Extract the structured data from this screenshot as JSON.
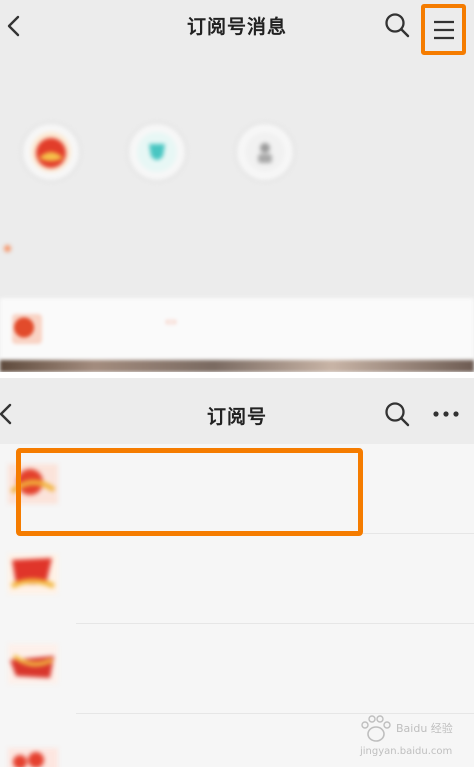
{
  "top_screen": {
    "title": "订阅号消息",
    "recent_label": "",
    "recent_accounts": [
      {
        "name": ""
      },
      {
        "name": ""
      },
      {
        "name": ""
      }
    ],
    "filters": [
      "",
      ""
    ],
    "feed_item": {
      "name": "",
      "tag": "",
      "time": ""
    }
  },
  "bottom_screen": {
    "title": "订阅号",
    "rows": [
      {
        "name": "",
        "snippet": "",
        "time": ""
      },
      {
        "name": "",
        "snippet": "",
        "time": ""
      },
      {
        "name": "",
        "snippet": "",
        "time": ""
      },
      {
        "name": "",
        "snippet": "",
        "time": ""
      }
    ]
  },
  "watermark": {
    "brand": "Baidu 经验",
    "url": "jingyan.baidu.com"
  },
  "colors": {
    "highlight": "#f57c00",
    "background": "#ededed"
  },
  "icons": [
    "back-icon",
    "search-icon",
    "menu-icon",
    "more-icon",
    "paw-icon"
  ]
}
